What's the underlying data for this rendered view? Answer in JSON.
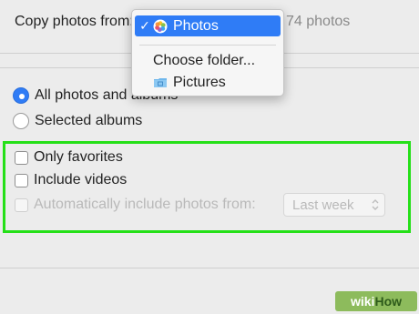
{
  "header": {
    "copy_label": "Copy photos from:",
    "count_label": "74 photos"
  },
  "dropdown": {
    "selected": {
      "check": "✓",
      "label": "Photos",
      "icon": "photos-app-icon"
    },
    "items": [
      {
        "label": "Choose folder..."
      },
      {
        "label": "Pictures",
        "icon": "folder-icon"
      }
    ]
  },
  "options": {
    "all_photos": {
      "label": "All photos and albums",
      "selected": true
    },
    "selected_albums": {
      "label": "Selected albums",
      "selected": false
    }
  },
  "filters": {
    "only_favorites": {
      "label": "Only favorites",
      "checked": false
    },
    "include_videos": {
      "label": "Include videos",
      "checked": false
    },
    "auto_include": {
      "label": "Automatically include photos from:",
      "checked": false,
      "enabled": false
    },
    "period_select": {
      "value": "Last week",
      "enabled": false
    }
  },
  "badge": {
    "wiki": "wiki",
    "how": "How"
  },
  "colors": {
    "accent": "#2f7cf6",
    "highlight_box": "#25e018",
    "badge_bg": "#8dbb5c"
  }
}
